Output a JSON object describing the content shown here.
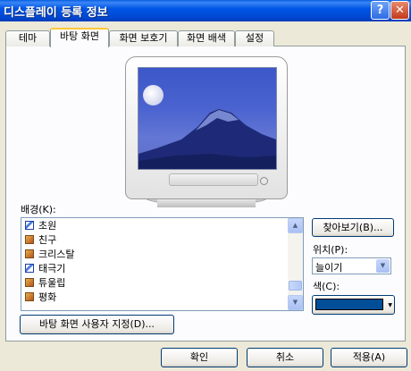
{
  "window": {
    "title": "디스플레이 등록 정보",
    "help_label": "?",
    "close_label": "✕"
  },
  "tabs": [
    {
      "label": "테마"
    },
    {
      "label": "바탕 화면"
    },
    {
      "label": "화면 보호기"
    },
    {
      "label": "화면 배색"
    },
    {
      "label": "설정"
    }
  ],
  "background": {
    "label": "배경(K):",
    "items": [
      {
        "label": "초원",
        "icon": "pen-icon"
      },
      {
        "label": "친구",
        "icon": "image-icon"
      },
      {
        "label": "크리스탈",
        "icon": "image-icon"
      },
      {
        "label": "태극기",
        "icon": "pen-icon"
      },
      {
        "label": "튜울립",
        "icon": "image-icon"
      },
      {
        "label": "평화",
        "icon": "image-icon"
      }
    ]
  },
  "browse_button": "찾아보기(B)...",
  "position": {
    "label": "위치(P):",
    "value": "늘이기"
  },
  "color": {
    "label": "색(C):",
    "value": "#004e98"
  },
  "customize_button": "바탕 화면 사용자 지정(D)...",
  "footer": {
    "ok": "확인",
    "cancel": "취소",
    "apply": "적용(A)"
  },
  "scroll_arrows": {
    "up": "▲",
    "down": "▼"
  }
}
